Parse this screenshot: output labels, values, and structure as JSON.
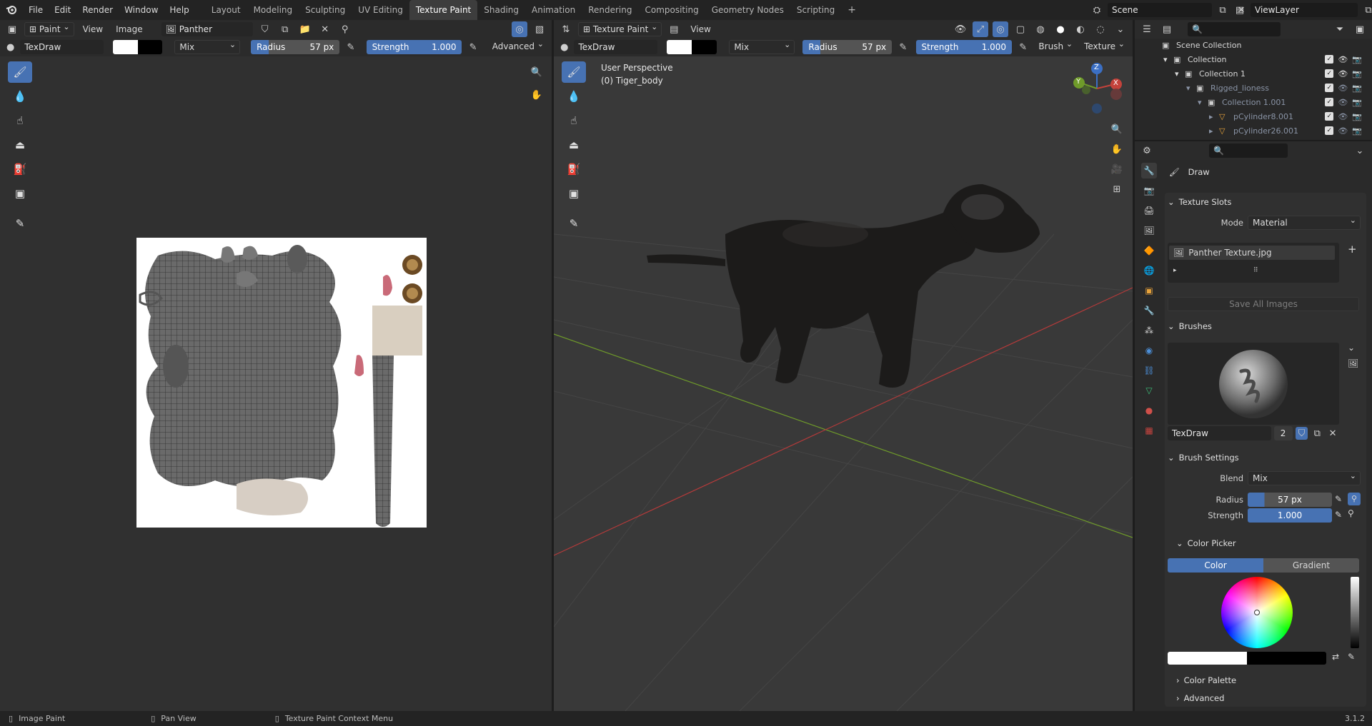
{
  "topbar": {
    "menu": [
      "File",
      "Edit",
      "Render",
      "Window",
      "Help"
    ],
    "workspaces": [
      "Layout",
      "Modeling",
      "Sculpting",
      "UV Editing",
      "Texture Paint",
      "Shading",
      "Animation",
      "Rendering",
      "Compositing",
      "Geometry Nodes",
      "Scripting"
    ],
    "active_workspace": "Texture Paint",
    "scene": "Scene",
    "view_layer": "ViewLayer"
  },
  "image_editor": {
    "mode": "Paint",
    "menus": [
      "View",
      "Image"
    ],
    "image_name": "Panther Texture.jpg",
    "brush": "TexDraw",
    "blend": "Mix",
    "radius_label": "Radius",
    "radius_value": "57 px",
    "strength_label": "Strength",
    "strength_value": "1.000",
    "advanced": "Advanced"
  },
  "viewport": {
    "mode": "Texture Paint",
    "menus": [
      "View"
    ],
    "brush": "TexDraw",
    "blend": "Mix",
    "radius_label": "Radius",
    "radius_value": "57 px",
    "strength_label": "Strength",
    "strength_value": "1.000",
    "brush_menu": "Brush",
    "texture_menu": "Texture",
    "perspective": "User Perspective",
    "object": "(0) Tiger_body",
    "gizmo": {
      "x": "X",
      "y": "Y",
      "z": "Z"
    },
    "colors": {
      "x_axis": "#b33a3a",
      "y_axis": "#6f9b2a"
    }
  },
  "outliner": {
    "rows": [
      {
        "label": "Scene Collection",
        "indent": 0
      },
      {
        "label": "Collection",
        "indent": 1
      },
      {
        "label": "Collection 1",
        "indent": 2
      },
      {
        "label": "Rigged_lioness",
        "indent": 3
      },
      {
        "label": "Collection 1.001",
        "indent": 4
      },
      {
        "label": "pCylinder8.001",
        "indent": 5
      },
      {
        "label": "pCylinder26.001",
        "indent": 5
      }
    ]
  },
  "properties": {
    "tool": "Draw",
    "texture_slots": {
      "title": "Texture Slots",
      "mode_label": "Mode",
      "mode_value": "Material",
      "slot": "Panther Texture.jpg",
      "save_all": "Save All Images"
    },
    "brushes": {
      "title": "Brushes",
      "brush_name": "TexDraw",
      "users": "2"
    },
    "brush_settings": {
      "title": "Brush Settings",
      "blend_label": "Blend",
      "blend_value": "Mix",
      "radius_label": "Radius",
      "radius_value": "57 px",
      "strength_label": "Strength",
      "strength_value": "1.000"
    },
    "color_picker": {
      "title": "Color Picker",
      "color_tab": "Color",
      "gradient_tab": "Gradient"
    },
    "color_palette": "Color Palette",
    "advanced": "Advanced"
  },
  "statusbar": {
    "left": "Image Paint",
    "middle": "Pan View",
    "right": "Texture Paint Context Menu",
    "version": "3.1.2"
  }
}
